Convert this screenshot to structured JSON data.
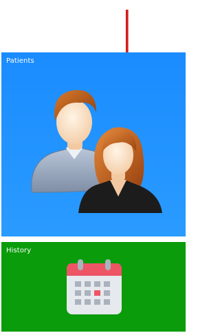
{
  "tiles": {
    "patients": {
      "label": "Patients",
      "icon": "people-icon",
      "color": "#1e90ff"
    },
    "history": {
      "label": "History",
      "icon": "calendar-icon",
      "color": "#0a9c0a"
    }
  },
  "annotation": {
    "icon": "arrow-down-icon",
    "color": "#e00000"
  }
}
